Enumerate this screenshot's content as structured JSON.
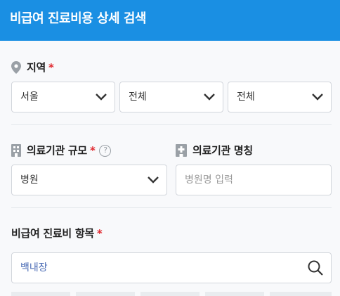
{
  "header": {
    "title": "비급여 진료비용 상세 검색"
  },
  "region": {
    "label": "지역",
    "required": "*",
    "selects": [
      "서울",
      "전체",
      "전체"
    ]
  },
  "institution": {
    "scale_label": "의료기관 규모",
    "required": "*",
    "help": "?",
    "scale_value": "병원",
    "name_label": "의료기관 명칭",
    "name_placeholder": "병원명 입력"
  },
  "item": {
    "label": "비급여 진료비 항목",
    "required": "*",
    "search_value": "백내장"
  },
  "colors": {
    "header": "#1a8fe3",
    "required": "#e0282e"
  }
}
